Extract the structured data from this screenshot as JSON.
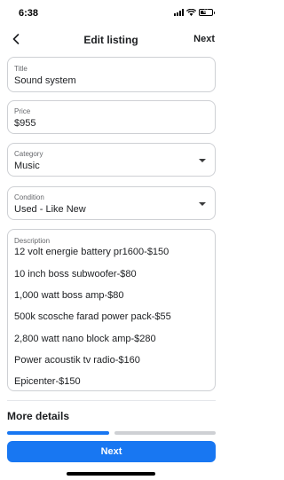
{
  "status_bar": {
    "time": "6:38",
    "battery_level": "41"
  },
  "nav": {
    "back_icon": "chevron-left-icon",
    "title": "Edit listing",
    "next_label": "Next"
  },
  "form": {
    "title": {
      "label": "Title",
      "value": "Sound system"
    },
    "price": {
      "label": "Price",
      "value": "$955"
    },
    "category": {
      "label": "Category",
      "value": "Music"
    },
    "condition": {
      "label": "Condition",
      "value": "Used - Like New"
    },
    "description": {
      "label": "Description",
      "lines": [
        "12 volt energie battery pr1600-$150",
        "10 inch boss subwoofer-$80",
        "1,000 watt boss amp-$80",
        "500k scosche farad power pack-$55",
        "2,800 watt nano block amp-$280",
        "Power acoustik tv radio-$160",
        "Epicenter-$150"
      ]
    }
  },
  "more_details": {
    "heading": "More details"
  },
  "progress": {
    "completed_fraction": 0.5
  },
  "footer": {
    "next_button_label": "Next"
  },
  "colors": {
    "accent": "#1877f2",
    "border": "#ced0d4",
    "label_gray": "#65676b",
    "text": "#1c1e21"
  }
}
